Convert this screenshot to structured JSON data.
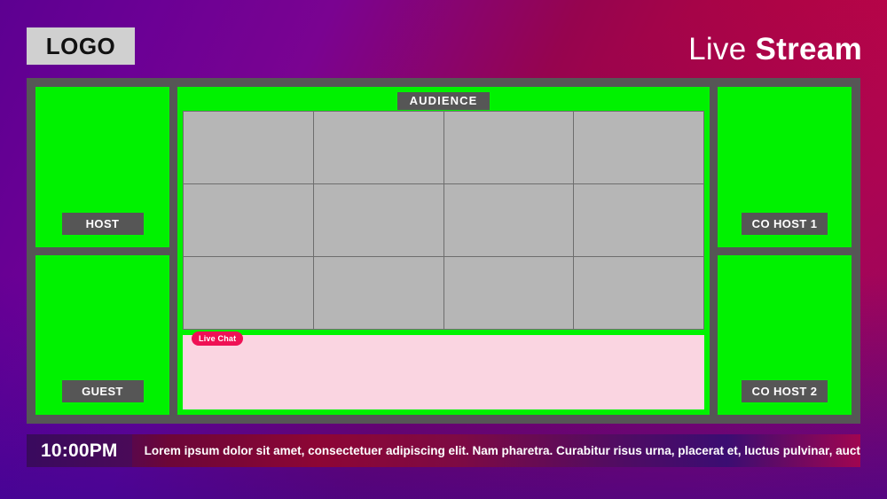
{
  "header": {
    "logo_text": "LOGO",
    "title_light": "Live",
    "title_bold": "Stream"
  },
  "colors": {
    "tile_green": "#00F200",
    "frame_gray": "#565656",
    "avatar_gray": "#6E6E6E",
    "audience_cell": "#B6B6B6",
    "chat_pink": "#FAD5E1",
    "chat_badge": "#EF1155",
    "logo_bg": "#D0D0D0",
    "bg_purple": "#5D0091",
    "bg_crimson": "#CF0541"
  },
  "stage": {
    "left_tiles": [
      {
        "label": "HOST",
        "avatar": "person-icon"
      },
      {
        "label": "GUEST",
        "avatar": "person-icon"
      }
    ],
    "right_tiles": [
      {
        "label": "CO HOST 1",
        "avatar": "person-icon"
      },
      {
        "label": "CO HOST 2",
        "avatar": "person-icon"
      }
    ],
    "audience": {
      "badge": "AUDIENCE",
      "rows": 3,
      "cols": 4,
      "cells": [
        {
          "avatar": "person-icon"
        },
        {
          "avatar": "person-icon"
        },
        {
          "avatar": "person-icon"
        },
        {
          "avatar": "person-icon"
        },
        {
          "avatar": "person-icon"
        },
        {
          "avatar": "person-icon"
        },
        {
          "avatar": "person-icon"
        },
        {
          "avatar": "person-icon"
        },
        {
          "avatar": "person-icon"
        },
        {
          "avatar": "person-icon"
        },
        {
          "avatar": "person-icon"
        },
        {
          "avatar": "person-icon"
        }
      ]
    },
    "chat": {
      "badge": "Live Chat",
      "messages": ""
    }
  },
  "ticker": {
    "time": "10:00PM",
    "text": "Lorem ipsum dolor sit amet, consectetuer adipiscing elit. Nam pharetra. Curabitur risus urna, placerat et, luctus pulvinar, auctor vel, orci."
  }
}
